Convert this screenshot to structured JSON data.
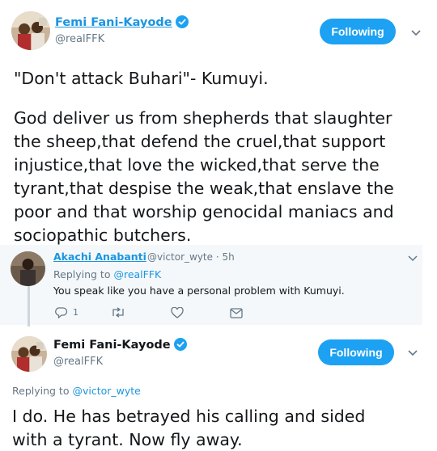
{
  "main_tweet": {
    "author_name": "Femi Fani-Kayode",
    "author_handle": "@realFFK",
    "follow_label": "Following",
    "line1": "\"Don't attack Buhari\"- Kumuyi.",
    "body_lines": [
      "God deliver us from shepherds that slaughter",
      "the sheep,that defend the cruel,that support",
      "injustice,that love the wicked,that serve the",
      "tyrant,that despise the weak,that enslave the",
      "poor and that worship genocidal maniacs and",
      "sociopathic butchers."
    ]
  },
  "reply": {
    "author_name": "Akachi Anabanti",
    "author_handle": "@victor_wyte",
    "time": "5h",
    "replying_label": "Replying to",
    "replying_handle": "@realFFK",
    "text": "You speak like you have a personal problem with Kumuyi.",
    "reply_count": "1",
    "icons": [
      "reply-icon",
      "retweet-icon",
      "like-icon",
      "message-icon"
    ]
  },
  "second_tweet": {
    "author_name": "Femi Fani-Kayode",
    "author_handle": "@realFFK",
    "follow_label": "Following",
    "replying_label": "Replying to",
    "replying_handle": "@victor_wyte",
    "text_lines": [
      "I do. He has betrayed his calling and sided",
      "with a tyrant. Now fly away."
    ]
  },
  "colors": {
    "accent": "#1da1f2",
    "link": "#1b95e0",
    "muted": "#657786",
    "reply_bg": "#f5f8fa"
  }
}
